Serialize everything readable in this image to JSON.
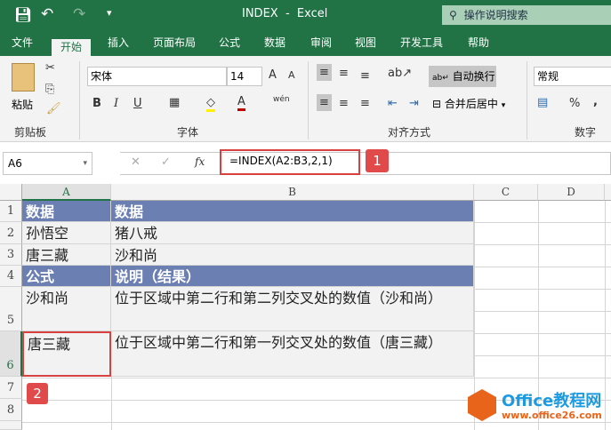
{
  "titlebar": {
    "title": "INDEX  -  Excel",
    "search_placeholder": "操作说明搜索"
  },
  "tabs": [
    "文件",
    "开始",
    "插入",
    "页面布局",
    "公式",
    "数据",
    "审阅",
    "视图",
    "开发工具",
    "帮助"
  ],
  "ribbon": {
    "clipboard": {
      "paste": "粘贴",
      "label": "剪贴板"
    },
    "font": {
      "name": "宋体",
      "size": "14",
      "label": "字体",
      "bold": "B",
      "italic": "I",
      "underline": "U",
      "phonetic": "wén"
    },
    "alignment": {
      "wrap": "自动换行",
      "merge": "合并后居中",
      "label": "对齐方式"
    },
    "number": {
      "format": "常规",
      "percent": "%",
      "comma": ",",
      "label": "数字"
    }
  },
  "formula_bar": {
    "name_box": "A6",
    "formula": "=INDEX(A2:B3,2,1)",
    "fx": "fx"
  },
  "callouts": [
    "1",
    "2"
  ],
  "columns": [
    "A",
    "B",
    "C",
    "D"
  ],
  "rows": [
    "1",
    "2",
    "3",
    "4",
    "5",
    "6",
    "7",
    "8"
  ],
  "cells": {
    "A1": "数据",
    "B1": "数据",
    "A2": "孙悟空",
    "B2": "猪八戒",
    "A3": "唐三藏",
    "B3": "沙和尚",
    "A4": "公式",
    "B4": "说明（结果）",
    "A5": "沙和尚",
    "B5": "位于区域中第二行和第二列交叉处的数值（沙和尚）",
    "A6": "唐三藏",
    "B6": "位于区域中第二行和第一列交叉处的数值（唐三藏）"
  },
  "watermark": {
    "brand": "Office教程网",
    "url": "www.office26.com"
  },
  "colors": {
    "excel_green": "#217346",
    "header_fill": "#6b7fb3",
    "callout_red": "#e04a4a"
  }
}
